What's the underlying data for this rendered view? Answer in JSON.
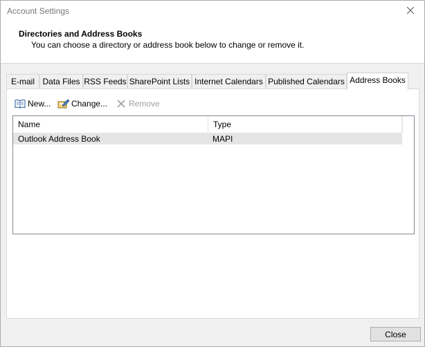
{
  "window": {
    "title": "Account Settings"
  },
  "header": {
    "title": "Directories and Address Books",
    "subtitle": "You can choose a directory or address book below to change or remove it."
  },
  "tabs": [
    {
      "label": "E-mail",
      "active": false
    },
    {
      "label": "Data Files",
      "active": false
    },
    {
      "label": "RSS Feeds",
      "active": false
    },
    {
      "label": "SharePoint Lists",
      "active": false
    },
    {
      "label": "Internet Calendars",
      "active": false
    },
    {
      "label": "Published Calendars",
      "active": false
    },
    {
      "label": "Address Books",
      "active": true
    }
  ],
  "toolbar": {
    "new_label": "New...",
    "change_label": "Change...",
    "remove_label": "Remove",
    "new_icon": "address-book-icon",
    "change_icon": "edit-icon",
    "remove_icon": "close-icon"
  },
  "list": {
    "columns": [
      "Name",
      "Type"
    ],
    "rows": [
      {
        "name": "Outlook Address Book",
        "type": "MAPI"
      }
    ]
  },
  "footer": {
    "close_label": "Close"
  },
  "colors": {
    "window_bg": "#f0f0f0",
    "header_bg": "#ffffff",
    "selected_row": "#e5e5e5",
    "border": "#d9d9d9"
  }
}
